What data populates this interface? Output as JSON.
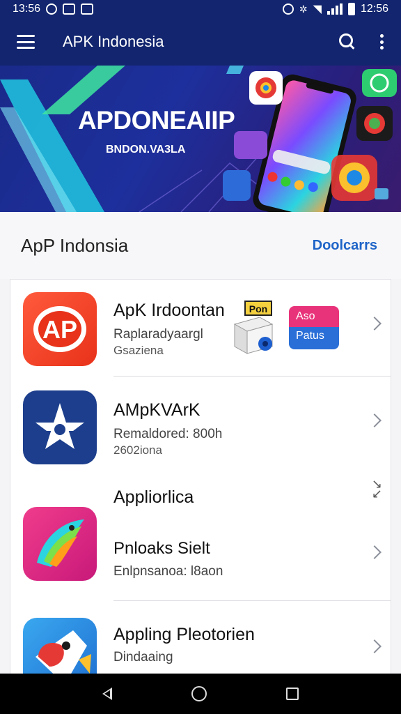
{
  "status_bar": {
    "time_left": "13:56",
    "time_right": "12:56"
  },
  "app_bar": {
    "title": "APK Indonesia",
    "icons": [
      "menu-icon",
      "search-icon",
      "more-vert-icon"
    ]
  },
  "banner": {
    "title": "APDONEAIIP",
    "subtitle": "BNDON.VA3LA"
  },
  "section": {
    "title": "ApP Indonsia",
    "link": "Doolcarrs"
  },
  "apps": [
    {
      "name": "ApK Irdoontan",
      "line1": "Raplaradyaargl",
      "line2": "Gsaziena",
      "icon_text": "AP",
      "badge_top": "Pon",
      "badge_card_1": "Aso",
      "badge_card_2": "Patus"
    },
    {
      "name": "AMpKVArK",
      "line1": "Remaldored: 800h",
      "line2": "2602iona"
    },
    {
      "name": "Appliorlica",
      "line1": "Pnloaks Sielt",
      "line2": "Enlpnsanoa: l8aon"
    },
    {
      "name": "Appling Pleotorien",
      "line1": "Dindaaing"
    }
  ],
  "colors": {
    "primary": "#12256e",
    "accent": "#1e64c8",
    "app1_icon": "#f04a25",
    "app2_icon": "#1c3e8c",
    "app3_icon": "#d4237a",
    "app4_icon": "#2a8fe0"
  }
}
